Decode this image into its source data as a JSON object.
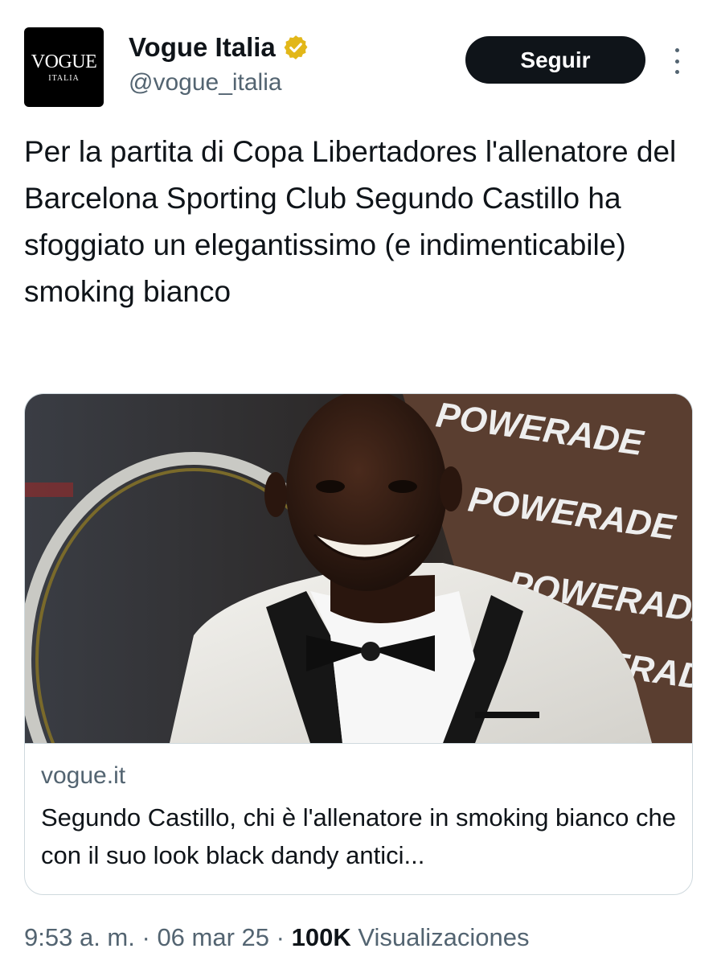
{
  "account": {
    "avatar_logo": "VOGUE",
    "avatar_sub": "ITALIA",
    "display_name": "Vogue Italia",
    "handle": "@vogue_italia",
    "verified_badge_color": "#e2b719"
  },
  "actions": {
    "follow_label": "Seguir",
    "more_icon": "more-vertical-icon"
  },
  "tweet": {
    "text": "Per la partita di Copa Libertadores l'allenatore del Barcelona Sporting Club Segundo Castillo ha sfoggiato un elegantissimo (e indimenticabile) smoking bianco"
  },
  "card": {
    "image_banner_text": [
      "POWERADE",
      "POWERADE",
      "POWERADE",
      "ERADE"
    ],
    "domain": "vogue.it",
    "title": "Segundo Castillo, chi è l'allenatore in smoking bianco che con il suo look black dandy antici..."
  },
  "footer": {
    "time": "9:53 a. m.",
    "separator": "·",
    "date": "06 mar 25",
    "views_count": "100K",
    "views_label": "Visualizaciones"
  },
  "colors": {
    "text_primary": "#0f1419",
    "text_secondary": "#536471",
    "border": "#cfd9de",
    "button_bg": "#0f1419"
  }
}
